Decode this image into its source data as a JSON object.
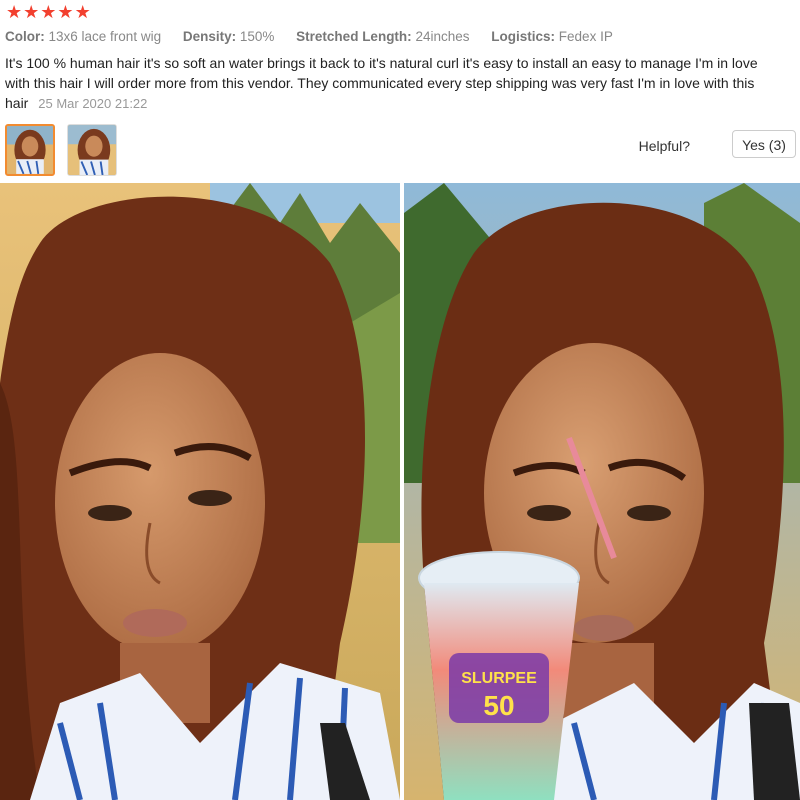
{
  "rating": {
    "stars": 5,
    "star_glyph": "★",
    "color": "#f2402f"
  },
  "attributes": [
    {
      "key": "Color:",
      "value": "13x6 lace front wig"
    },
    {
      "key": "Density:",
      "value": "150%"
    },
    {
      "key": "Stretched Length:",
      "value": "24inches"
    },
    {
      "key": "Logistics:",
      "value": "Fedex IP"
    }
  ],
  "review": {
    "text": "It's 100 % human hair it's so soft an water brings it back to it's natural curl it's easy to install an easy to manage I'm in love with this hair I will order more from this vendor. They communicated every step shipping was very fast I'm in love with this hair",
    "date": "25 Mar 2020 21:22"
  },
  "helpful": {
    "label": "Helpful?",
    "yes_label": "Yes (3)"
  },
  "photos": {
    "drink_cup_text_top": "SLURPEE",
    "drink_cup_text_bottom": "50"
  }
}
